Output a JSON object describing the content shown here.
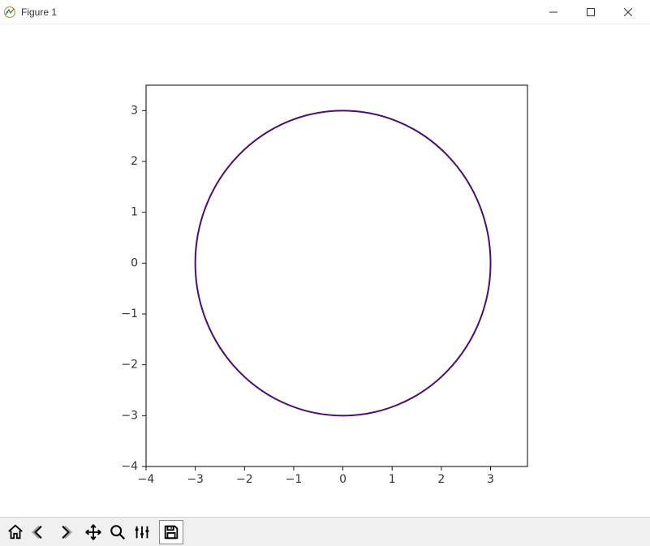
{
  "window": {
    "title": "Figure 1",
    "buttons": {
      "min": "minimize",
      "max": "maximize",
      "close": "close"
    }
  },
  "toolbar": {
    "items": [
      {
        "name": "home",
        "label": "Home"
      },
      {
        "name": "back",
        "label": "Back"
      },
      {
        "name": "forward",
        "label": "Forward"
      },
      {
        "name": "pan",
        "label": "Pan"
      },
      {
        "name": "zoom",
        "label": "Zoom"
      },
      {
        "name": "configure",
        "label": "Configure subplots"
      },
      {
        "name": "save",
        "label": "Save"
      }
    ]
  },
  "chart_data": {
    "type": "line",
    "title": "",
    "xlabel": "",
    "ylabel": "",
    "xlim": [
      -4,
      3.75
    ],
    "ylim": [
      -4,
      3.5
    ],
    "xticks": [
      -4,
      -3,
      -2,
      -1,
      0,
      1,
      2,
      3
    ],
    "yticks": [
      -4,
      -3,
      -2,
      -1,
      0,
      1,
      2,
      3
    ],
    "series": [
      {
        "name": "circle",
        "shape": "circle",
        "cx": 0,
        "cy": 0,
        "r": 3,
        "color": "#4b0f6b"
      }
    ],
    "grid": false,
    "legend": false,
    "accent_color": "#4b0f6b"
  }
}
